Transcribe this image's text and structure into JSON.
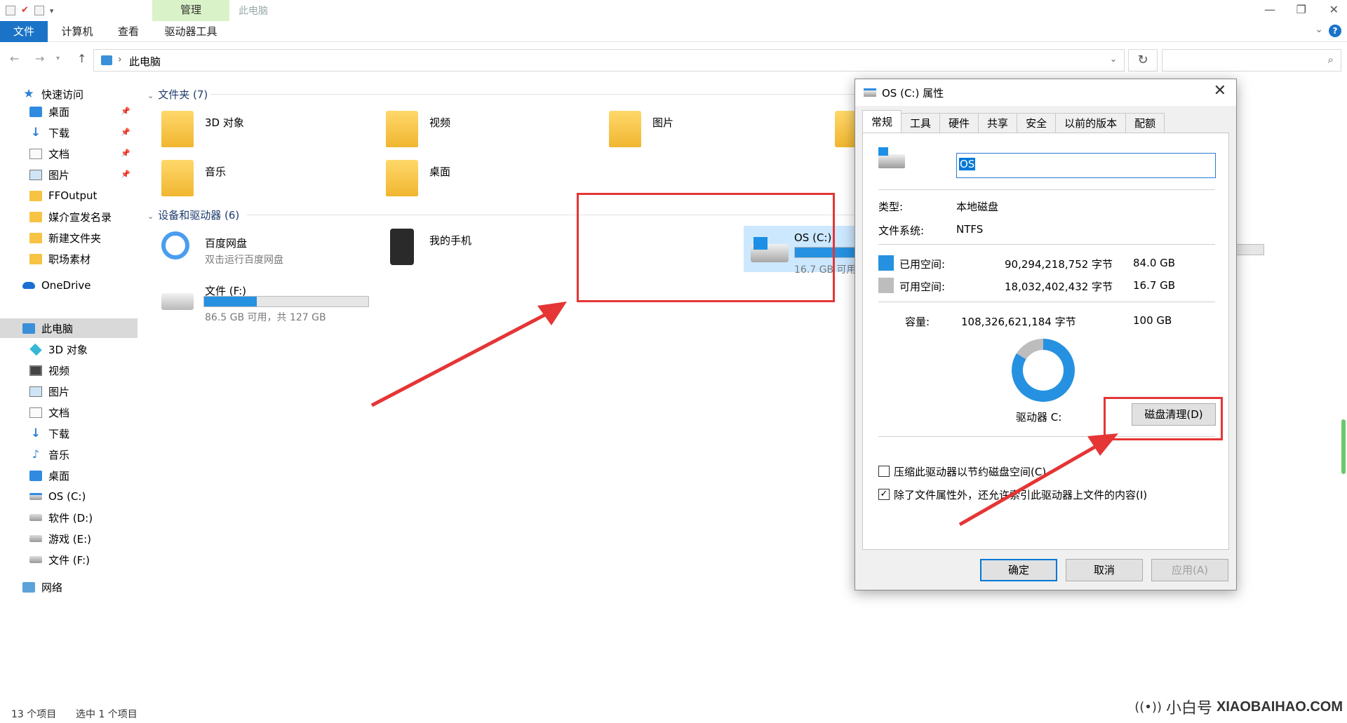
{
  "window": {
    "manage_tab": "管理",
    "title": "此电脑"
  },
  "ribbon": {
    "tabs": [
      "文件",
      "计算机",
      "查看",
      "驱动器工具"
    ]
  },
  "address": {
    "path": "此电脑"
  },
  "sidebar": {
    "items": [
      {
        "label": "快速访问",
        "icon": "star-icon"
      },
      {
        "label": "桌面",
        "icon": "desktop-icon"
      },
      {
        "label": "下载",
        "icon": "download-icon"
      },
      {
        "label": "文档",
        "icon": "document-icon"
      },
      {
        "label": "图片",
        "icon": "picture-icon"
      },
      {
        "label": "FFOutput",
        "icon": "folder-icon"
      },
      {
        "label": "媒介宣发名录",
        "icon": "folder-icon"
      },
      {
        "label": "新建文件夹",
        "icon": "folder-icon"
      },
      {
        "label": "职场素材",
        "icon": "folder-icon"
      },
      {
        "label": "OneDrive",
        "icon": "cloud-icon"
      },
      {
        "label": "此电脑",
        "icon": "computer-icon"
      },
      {
        "label": "3D 对象",
        "icon": "cube-icon"
      },
      {
        "label": "视频",
        "icon": "video-icon"
      },
      {
        "label": "图片",
        "icon": "picture-icon"
      },
      {
        "label": "文档",
        "icon": "document-icon"
      },
      {
        "label": "下载",
        "icon": "download-icon"
      },
      {
        "label": "音乐",
        "icon": "music-icon"
      },
      {
        "label": "桌面",
        "icon": "desktop-icon"
      },
      {
        "label": "OS (C:)",
        "icon": "os-drive-icon"
      },
      {
        "label": "软件 (D:)",
        "icon": "drive-icon"
      },
      {
        "label": "游戏 (E:)",
        "icon": "drive-icon"
      },
      {
        "label": "文件 (F:)",
        "icon": "drive-icon"
      },
      {
        "label": "网络",
        "icon": "network-icon"
      }
    ]
  },
  "main": {
    "folders_header": "文件夹 (7)",
    "folders": [
      {
        "name": "3D 对象"
      },
      {
        "name": "视频"
      },
      {
        "name": "图片"
      },
      {
        "name": "音乐"
      },
      {
        "name": "桌面"
      }
    ],
    "devices_header": "设备和驱动器 (6)",
    "devices": [
      {
        "name": "百度网盘",
        "sub": "双击运行百度网盘"
      },
      {
        "name": "我的手机",
        "sub": ""
      },
      {
        "name": "文件 (F:)",
        "sub": "86.5 GB 可用，共 127 GB",
        "used_fraction": 0.32
      }
    ],
    "selected_drive": {
      "name": "OS (C:)",
      "sub": "16.7 GB 可用，共 100 GB",
      "used_fraction": 0.84
    }
  },
  "status": {
    "count": "13 个项目",
    "selected": "选中 1 个项目"
  },
  "dialog": {
    "title": "OS (C:) 属性",
    "tabs": [
      "常规",
      "工具",
      "硬件",
      "共享",
      "安全",
      "以前的版本",
      "配额"
    ],
    "active_tab": "常规",
    "volume_name": "OS",
    "type_label": "类型:",
    "type_value": "本地磁盘",
    "fs_label": "文件系统:",
    "fs_value": "NTFS",
    "used_label": "已用空间:",
    "used_bytes": "90,294,218,752 字节",
    "used_gb": "84.0 GB",
    "free_label": "可用空间:",
    "free_bytes": "18,032,402,432 字节",
    "free_gb": "16.7 GB",
    "cap_label": "容量:",
    "cap_bytes": "108,326,621,184 字节",
    "cap_gb": "100 GB",
    "drive_label": "驱动器 C:",
    "cleanup_button": "磁盘清理(D)",
    "compress_label": "压缩此驱动器以节约磁盘空间(C)",
    "compress_checked": false,
    "index_label": "除了文件属性外，还允许索引此驱动器上文件的内容(I)",
    "index_checked": true,
    "ok": "确定",
    "cancel": "取消",
    "apply": "应用(A)",
    "used_fraction": 0.84,
    "colors": {
      "used": "#2691e0",
      "free": "#bdbdbd"
    }
  },
  "watermark": {
    "brand": "小白号",
    "site": "XIAOBAIHAO.COM"
  }
}
